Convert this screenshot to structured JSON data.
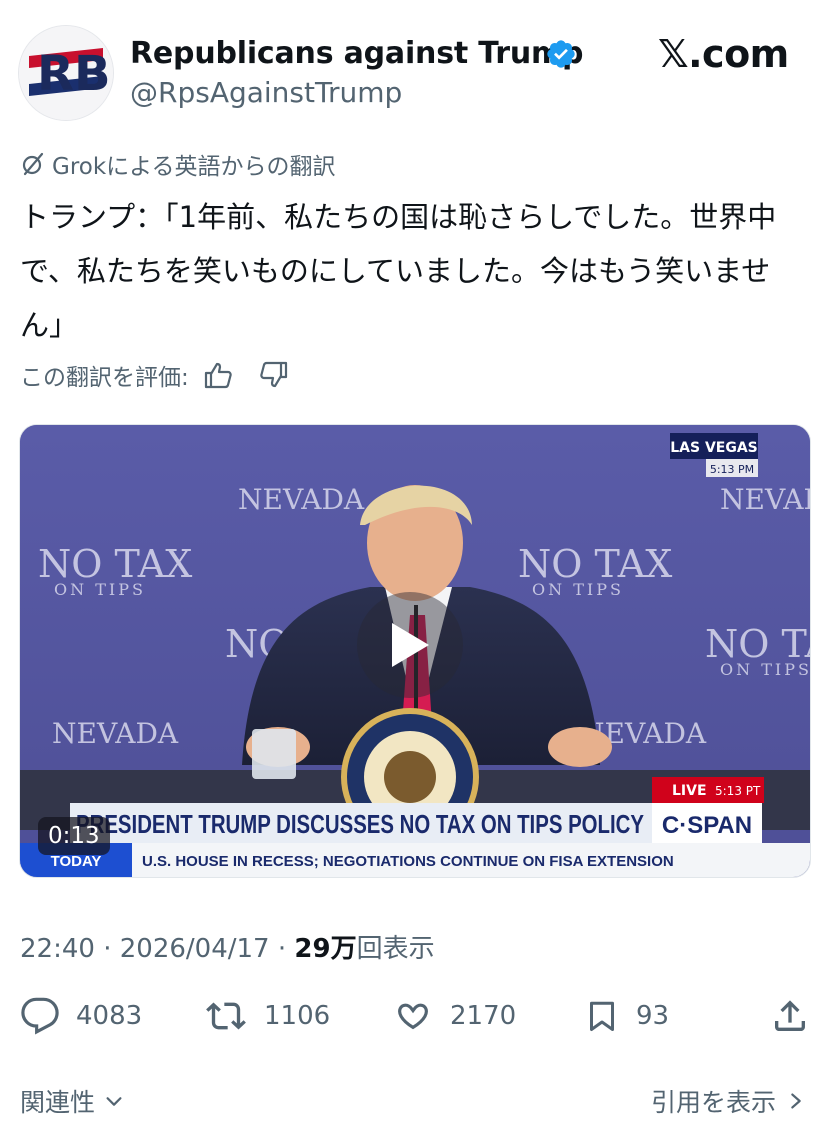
{
  "author": {
    "name": "Republicans against Trump",
    "handle": "@RpsAgainstTrump",
    "avatar_letters": "RB",
    "verified": true
  },
  "site_logo": "𝕏.com",
  "translation": {
    "notice": "Grokによる英語からの翻訳",
    "text": "トランプ：「1年前、私たちの国は恥さらしでした。世界中で、私たちを笑いものにしていました。今はもう笑いません」",
    "rate_label": "この翻訳を評価:"
  },
  "video": {
    "duration": "0:13",
    "backdrop_texts": [
      "NEVADA",
      "LAS VEGAS",
      "NO TAX",
      "ON TIPS"
    ],
    "location_badge": "LAS VEGAS",
    "time_badge": "5:13 PM",
    "live_label": "LIVE",
    "live_time": "5:13 PT",
    "network": "C·SPAN",
    "lower_third_headline": "PRESIDENT TRUMP DISCUSSES NO TAX ON TIPS POLICY",
    "ticker_label": "TODAY",
    "ticker_text": "U.S. HOUSE IN RECESS; NEGOTIATIONS CONTINUE ON FISA EXTENSION",
    "seal_text": "PRESIDENT OF THE UNITED"
  },
  "meta": {
    "time": "22:40",
    "date": "2026/04/17",
    "views_number": "29万",
    "views_suffix": "回表示",
    "separator": "·"
  },
  "actions": {
    "replies": "4083",
    "reposts": "1106",
    "likes": "2170",
    "bookmarks": "93"
  },
  "footer": {
    "related_label": "関連性",
    "quotes_label": "引用を表示"
  },
  "colors": {
    "accent": "#1d9bf0",
    "secondary_text": "#536471",
    "backdrop": "#585aa4",
    "cspan_red": "#d0021b",
    "tie": "#d51c52"
  }
}
